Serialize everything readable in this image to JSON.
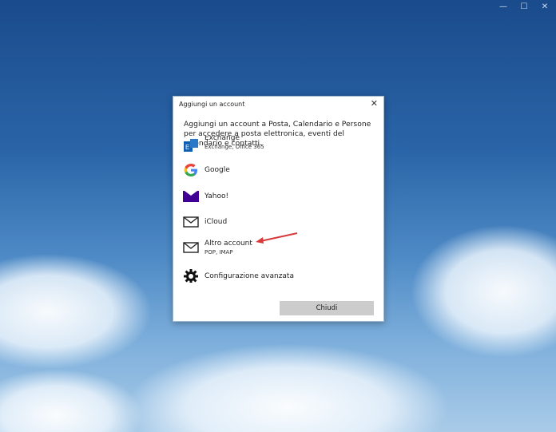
{
  "window_controls": {
    "minimize": "—",
    "maximize": "☐",
    "close": "✕"
  },
  "dialog": {
    "title": "Aggiungi un account",
    "close": "✕",
    "intro": "Aggiungi un account a Posta, Calendario e Persone per accedere a posta elettronica, eventi del calendario e contatti.",
    "items": [
      {
        "label": "Exchange",
        "sub": "Exchange, Office 365",
        "icon": "exchange-icon"
      },
      {
        "label": "Google",
        "icon": "google-icon"
      },
      {
        "label": "Yahoo!",
        "icon": "yahoo-mail-icon"
      },
      {
        "label": "iCloud",
        "icon": "envelope-icon"
      },
      {
        "label": "Altro account",
        "sub": "POP, IMAP",
        "icon": "envelope-icon"
      },
      {
        "label": "Configurazione avanzata",
        "icon": "gear-icon"
      }
    ],
    "close_button": "Chiudi"
  },
  "colors": {
    "exchange": "#0f5fb3",
    "yahoo": "#410093",
    "annotation_arrow": "#d83a3a",
    "button": "#cccccc"
  }
}
